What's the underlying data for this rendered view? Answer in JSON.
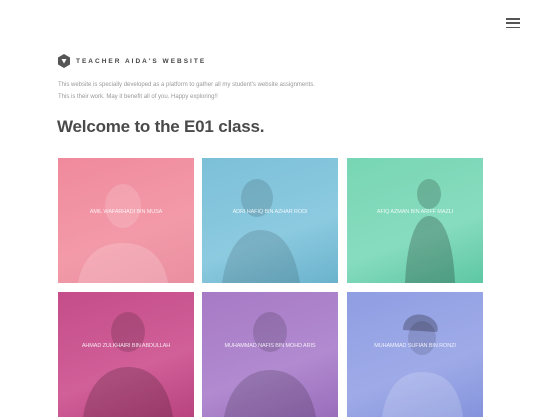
{
  "header": {
    "brand_title": "TEACHER AIDA'S WEBSITE",
    "menu_icon": "hamburger-menu-icon",
    "logo_icon": "hexagon-logo-icon"
  },
  "intro": {
    "line1": "This website is specially developed as a platform to gather all my student's website assignments.",
    "line2": "This is their work. May it benefit all of you. Happy exploring!!"
  },
  "heading": "Welcome to the E01 class.",
  "students": [
    {
      "name": "AMIL WAFARHADI BIN MUSA",
      "color": "#ef8a9c"
    },
    {
      "name": "ADRI HAFIQ BIN AZHAR RODI",
      "color": "#7cc0d8"
    },
    {
      "name": "AFIQ AZMAN BIN ARIFF MAZLI",
      "color": "#78d6b4"
    },
    {
      "name": "AHMAD ZULKHAIRI BIN ABDULLAH",
      "color": "#c44d8a"
    },
    {
      "name": "MUHAMMAD NAFIS BIN MOHD ARIS",
      "color": "#a77ac5"
    },
    {
      "name": "MUHAMMAD SUFIAN BIN RONZI",
      "color": "#8f9de2"
    }
  ]
}
